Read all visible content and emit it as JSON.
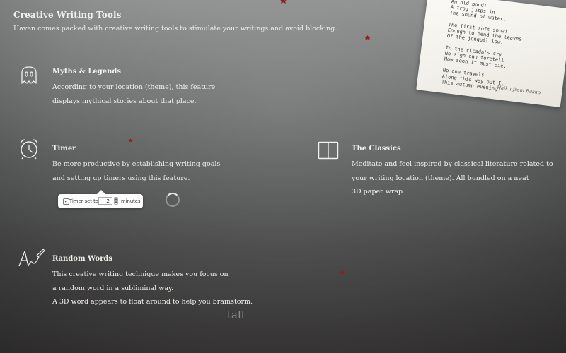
{
  "header": {
    "title": "Creative Writing Tools",
    "subtitle": "Haven comes packed with creative writing tools to stimulate your writings and avoid blocking..."
  },
  "features": {
    "myths": {
      "title": "Myths & Legends",
      "desc1": "According to your location (theme), this feature",
      "desc2": "displays mythical stories about that place.",
      "icon": "ghost-icon"
    },
    "timer": {
      "title": "Timer",
      "desc1": "Be more productive by establishing writing goals",
      "desc2": "and setting up timers using this feature.",
      "icon": "alarm-clock-icon"
    },
    "classics": {
      "title": "The Classics",
      "desc1": "Meditate and feel inspired by classical literature related to",
      "desc2": "your writing location (theme). All bundled on a neat",
      "desc3": "3D paper wrap.",
      "icon": "open-book-icon"
    },
    "random": {
      "title": "Random Words",
      "desc1": "This creative writing technique makes you focus on",
      "desc2": "a random word in a subliminal way.",
      "desc3": "A 3D word appears to float around to help you brainstorm.",
      "icon": "pen-writing-icon"
    }
  },
  "timer_popover": {
    "checkbox_checked": true,
    "label": "Timer set to:",
    "value": "2",
    "unit": "minutes"
  },
  "haiku": {
    "lines": "An old pond!\nA frog jumps in -\nThe sound of water.\n\nThe first soft snow!\nEnough to bend the leaves\nOf the jonquil low.\n\nIn the cicada's cry\nNo sign can foretell\nHow soon it must die.\n\nNo one travels\nAlong this way but I,\nThis autumn evening.",
    "credit": "Haiku from Basho"
  },
  "floating_word": "tall",
  "colors": {
    "leaf": "#9b1a1a",
    "text": "#f2f0ec"
  }
}
